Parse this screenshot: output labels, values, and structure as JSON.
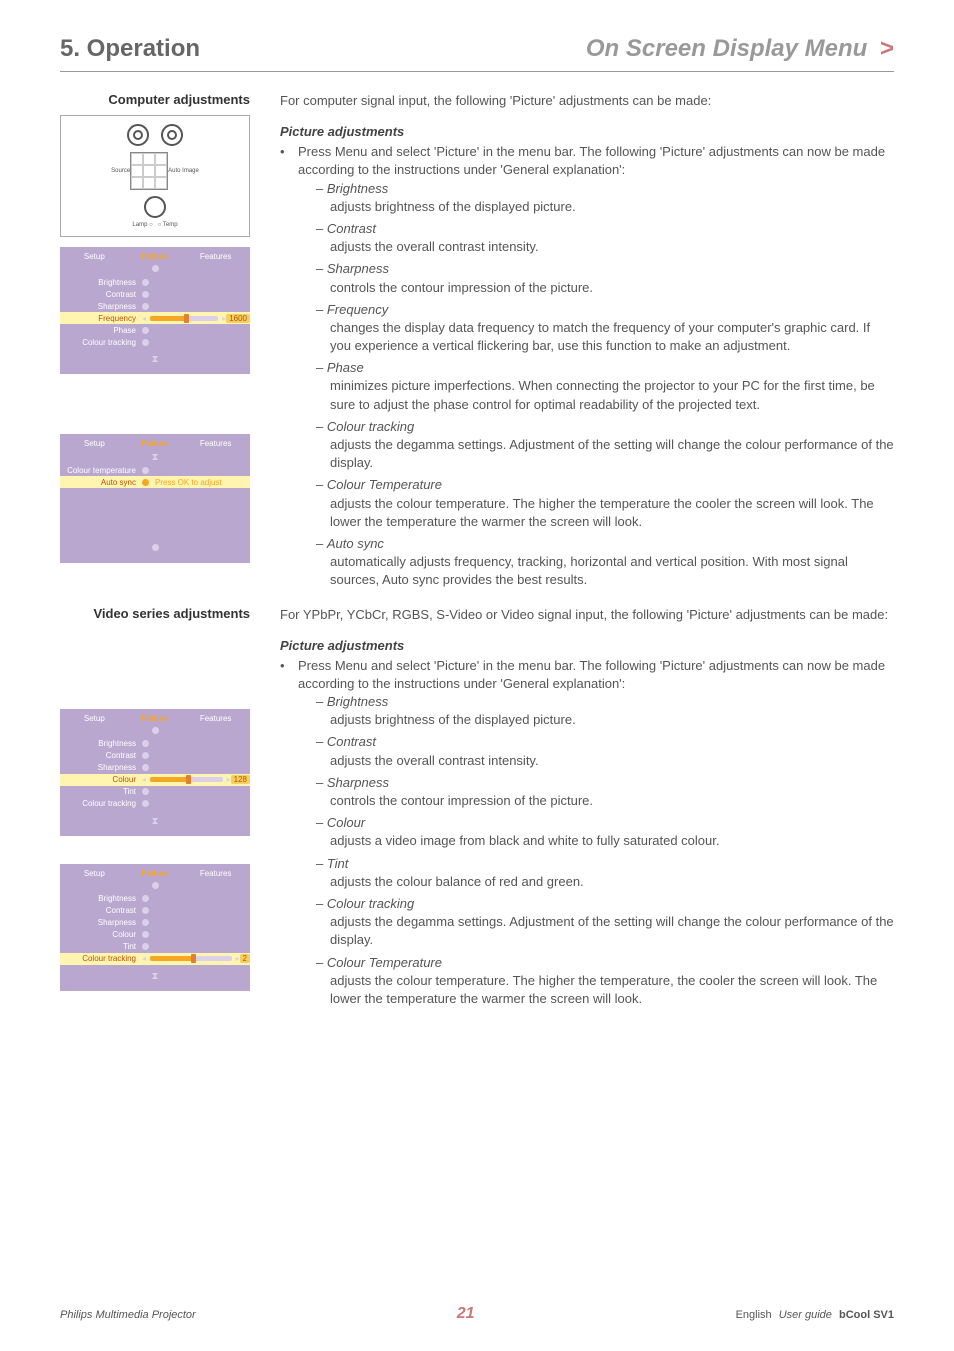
{
  "header": {
    "chapter": "5. Operation",
    "subtitle": "On Screen Display Menu",
    "chevron": ">"
  },
  "sections": {
    "computer": {
      "sideHeading": "Computer adjustments",
      "intro": "For computer signal input, the following 'Picture' adjustments can be made:",
      "picAdjHead": "Picture adjustments",
      "bullet": "Press Menu and select 'Picture' in the menu bar. The following 'Picture' adjustments can now be made according to the instructions under 'General explanation':",
      "items": [
        {
          "name": "Brightness",
          "desc": "adjusts brightness of the displayed picture."
        },
        {
          "name": "Contrast",
          "desc": "adjusts the overall contrast intensity."
        },
        {
          "name": "Sharpness",
          "desc": "controls the contour impression of the picture."
        },
        {
          "name": "Frequency",
          "desc": "changes the display data frequency to match the frequency of your computer's graphic card. If you experience a vertical flickering bar, use this function to make an adjustment."
        },
        {
          "name": "Phase",
          "desc": "minimizes picture imperfections. When connecting the projector to your PC for the first time, be sure to adjust the phase control for optimal readability of the projected text."
        },
        {
          "name": "Colour tracking",
          "desc": "adjusts the degamma settings. Adjustment of the setting will change the colour performance of the display."
        },
        {
          "name": "Colour Temperature",
          "desc": "adjusts the colour temperature. The higher the temperature the cooler the screen will look. The lower the temperature the warmer the screen will look."
        },
        {
          "name": "Auto sync",
          "desc": "automatically adjusts frequency, tracking, horizontal and vertical position. With most signal sources, Auto sync provides the best results."
        }
      ]
    },
    "video": {
      "sideHeading": "Video series adjustments",
      "intro": "For YPbPr, YCbCr, RGBS, S-Video or Video signal input, the following 'Picture' adjustments can be made:",
      "picAdjHead": "Picture adjustments",
      "bullet": "Press Menu and select 'Picture' in the menu bar. The following 'Picture' adjustments can now be made according to the instructions under 'General explanation':",
      "items": [
        {
          "name": "Brightness",
          "desc": "adjusts brightness of the displayed picture."
        },
        {
          "name": "Contrast",
          "desc": "adjusts the overall contrast intensity."
        },
        {
          "name": "Sharpness",
          "desc": "controls the contour impression of the picture."
        },
        {
          "name": "Colour",
          "desc": "adjusts a video image from black and white to fully saturated colour."
        },
        {
          "name": "Tint",
          "desc": "adjusts the colour balance of red and green."
        },
        {
          "name": "Colour tracking",
          "desc": "adjusts the degamma settings. Adjustment of the setting will change the colour performance of the display."
        },
        {
          "name": "Colour Temperature",
          "desc": "adjusts the colour temperature. The higher the temperature, the cooler the screen will look. The lower the temperature the warmer the screen will look."
        }
      ]
    }
  },
  "device": {
    "source": "Source",
    "autoImage": "Auto Image",
    "lamp": "Lamp",
    "temp": "Temp"
  },
  "osd": {
    "tabs": [
      "Setup",
      "Picture",
      "Features"
    ],
    "menu1": {
      "rows": [
        "Brightness",
        "Contrast",
        "Sharpness",
        "Frequency",
        "Phase",
        "Colour tracking"
      ],
      "selected": "Frequency",
      "value": "1600"
    },
    "menu2": {
      "rows": [
        "Colour temperature",
        "Auto sync"
      ],
      "selected": "Auto sync",
      "hint": "Press OK to adjust"
    },
    "menu3": {
      "rows": [
        "Brightness",
        "Contrast",
        "Sharpness",
        "Colour",
        "Tint",
        "Colour tracking"
      ],
      "selected": "Colour",
      "value": "128"
    },
    "menu4": {
      "rows": [
        "Brightness",
        "Contrast",
        "Sharpness",
        "Colour",
        "Tint",
        "Colour tracking"
      ],
      "selected": "Colour tracking",
      "value": "2"
    }
  },
  "footer": {
    "brand": "Philips Multimedia Projector",
    "page": "21",
    "lang": "English",
    "guide": "User guide",
    "model": "bCool SV1"
  }
}
